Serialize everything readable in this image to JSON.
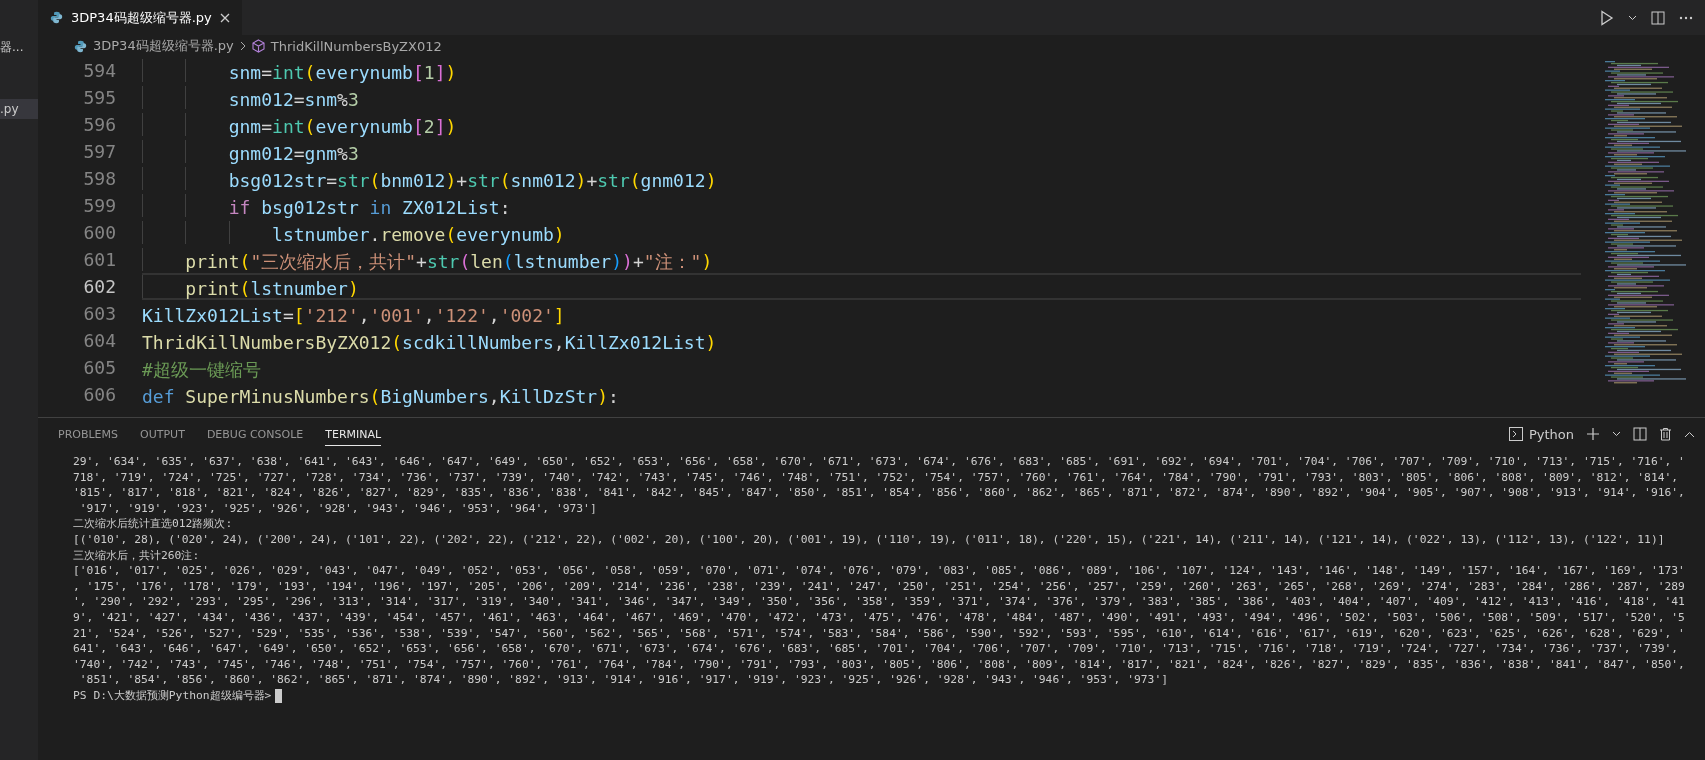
{
  "sidebar_fragment": {
    "items": [
      {
        "label": "器...",
        "selected": false
      },
      {
        "label": ".py",
        "selected": true
      }
    ]
  },
  "editor_tabs": [
    {
      "label": "3DP34码超级缩号器.py",
      "selected": true
    }
  ],
  "breadcrumb": [
    {
      "label": "3DP34码超级缩号器.py",
      "kind": "file"
    },
    {
      "label": "ThridKillNumbersByZX012",
      "kind": "symbol"
    }
  ],
  "code_lines": [
    {
      "number": "594",
      "selected": false,
      "tokens": [
        {
          "kind": "variable",
          "text": "        snm"
        },
        {
          "kind": "plain",
          "text": "="
        },
        {
          "kind": "builtin",
          "text": "int"
        },
        {
          "kind": "bracket1",
          "text": "("
        },
        {
          "kind": "variable",
          "text": "everynumb"
        },
        {
          "kind": "bracket2",
          "text": "["
        },
        {
          "kind": "number",
          "text": "1"
        },
        {
          "kind": "bracket2",
          "text": "]"
        },
        {
          "kind": "bracket1",
          "text": ")"
        }
      ]
    },
    {
      "number": "595",
      "selected": false,
      "tokens": [
        {
          "kind": "variable",
          "text": "        snm012"
        },
        {
          "kind": "plain",
          "text": "="
        },
        {
          "kind": "variable",
          "text": "snm"
        },
        {
          "kind": "plain",
          "text": "%"
        },
        {
          "kind": "number",
          "text": "3"
        }
      ]
    },
    {
      "number": "596",
      "selected": false,
      "tokens": [
        {
          "kind": "variable",
          "text": "        gnm"
        },
        {
          "kind": "plain",
          "text": "="
        },
        {
          "kind": "builtin",
          "text": "int"
        },
        {
          "kind": "bracket1",
          "text": "("
        },
        {
          "kind": "variable",
          "text": "everynumb"
        },
        {
          "kind": "bracket2",
          "text": "["
        },
        {
          "kind": "number",
          "text": "2"
        },
        {
          "kind": "bracket2",
          "text": "]"
        },
        {
          "kind": "bracket1",
          "text": ")"
        }
      ]
    },
    {
      "number": "597",
      "selected": false,
      "tokens": [
        {
          "kind": "variable",
          "text": "        gnm012"
        },
        {
          "kind": "plain",
          "text": "="
        },
        {
          "kind": "variable",
          "text": "gnm"
        },
        {
          "kind": "plain",
          "text": "%"
        },
        {
          "kind": "number",
          "text": "3"
        }
      ]
    },
    {
      "number": "598",
      "selected": false,
      "tokens": [
        {
          "kind": "variable",
          "text": "        bsg012str"
        },
        {
          "kind": "plain",
          "text": "="
        },
        {
          "kind": "builtin",
          "text": "str"
        },
        {
          "kind": "bracket1",
          "text": "("
        },
        {
          "kind": "variable",
          "text": "bnm012"
        },
        {
          "kind": "bracket1",
          "text": ")"
        },
        {
          "kind": "plain",
          "text": "+"
        },
        {
          "kind": "builtin",
          "text": "str"
        },
        {
          "kind": "bracket1",
          "text": "("
        },
        {
          "kind": "variable",
          "text": "snm012"
        },
        {
          "kind": "bracket1",
          "text": ")"
        },
        {
          "kind": "plain",
          "text": "+"
        },
        {
          "kind": "builtin",
          "text": "str"
        },
        {
          "kind": "bracket1",
          "text": "("
        },
        {
          "kind": "variable",
          "text": "gnm012"
        },
        {
          "kind": "bracket1",
          "text": ")"
        }
      ]
    },
    {
      "number": "599",
      "selected": false,
      "tokens": [
        {
          "kind": "control",
          "text": "        if "
        },
        {
          "kind": "variable",
          "text": "bsg012str "
        },
        {
          "kind": "operator",
          "text": "in "
        },
        {
          "kind": "variable",
          "text": "ZX012List"
        },
        {
          "kind": "plain",
          "text": ":"
        }
      ]
    },
    {
      "number": "600",
      "selected": false,
      "tokens": [
        {
          "kind": "variable",
          "text": "            lstnumber"
        },
        {
          "kind": "plain",
          "text": "."
        },
        {
          "kind": "function",
          "text": "remove"
        },
        {
          "kind": "bracket1",
          "text": "("
        },
        {
          "kind": "variable",
          "text": "everynumb"
        },
        {
          "kind": "bracket1",
          "text": ")"
        }
      ]
    },
    {
      "number": "601",
      "selected": false,
      "tokens": [
        {
          "kind": "function",
          "text": "    print"
        },
        {
          "kind": "bracket1",
          "text": "("
        },
        {
          "kind": "string",
          "text": "\"三次缩水后，共计\""
        },
        {
          "kind": "plain",
          "text": "+"
        },
        {
          "kind": "builtin",
          "text": "str"
        },
        {
          "kind": "bracket2",
          "text": "("
        },
        {
          "kind": "function",
          "text": "len"
        },
        {
          "kind": "bracket3",
          "text": "("
        },
        {
          "kind": "variable",
          "text": "lstnumber"
        },
        {
          "kind": "bracket3",
          "text": ")"
        },
        {
          "kind": "bracket2",
          "text": ")"
        },
        {
          "kind": "plain",
          "text": "+"
        },
        {
          "kind": "string",
          "text": "\"注：\""
        },
        {
          "kind": "bracket1",
          "text": ")"
        }
      ]
    },
    {
      "number": "602",
      "selected": true,
      "tokens": [
        {
          "kind": "function",
          "text": "    print"
        },
        {
          "kind": "bracket1",
          "text": "("
        },
        {
          "kind": "variable",
          "text": "lstnumber"
        },
        {
          "kind": "bracket1",
          "text": ")"
        }
      ]
    },
    {
      "number": "603",
      "selected": false,
      "tokens": [
        {
          "kind": "variable",
          "text": "KillZx012List"
        },
        {
          "kind": "plain",
          "text": "="
        },
        {
          "kind": "bracket1",
          "text": "["
        },
        {
          "kind": "string",
          "text": "'212'"
        },
        {
          "kind": "plain",
          "text": ","
        },
        {
          "kind": "string",
          "text": "'001'"
        },
        {
          "kind": "plain",
          "text": ","
        },
        {
          "kind": "string",
          "text": "'122'"
        },
        {
          "kind": "plain",
          "text": ","
        },
        {
          "kind": "string",
          "text": "'002'"
        },
        {
          "kind": "bracket1",
          "text": "]"
        }
      ]
    },
    {
      "number": "604",
      "selected": false,
      "tokens": [
        {
          "kind": "function",
          "text": "ThridKillNumbersByZX012"
        },
        {
          "kind": "bracket1",
          "text": "("
        },
        {
          "kind": "variable",
          "text": "scdkillNumbers"
        },
        {
          "kind": "plain",
          "text": ","
        },
        {
          "kind": "variable",
          "text": "KillZx012List"
        },
        {
          "kind": "bracket1",
          "text": ")"
        }
      ]
    },
    {
      "number": "605",
      "selected": false,
      "tokens": [
        {
          "kind": "comment",
          "text": "#超级一键缩号"
        }
      ]
    },
    {
      "number": "606",
      "selected": false,
      "tokens": [
        {
          "kind": "keyword",
          "text": "def "
        },
        {
          "kind": "function",
          "text": "SuperMinusNumbers"
        },
        {
          "kind": "bracket1",
          "text": "("
        },
        {
          "kind": "variable",
          "text": "BigNumbers"
        },
        {
          "kind": "plain",
          "text": ","
        },
        {
          "kind": "variable",
          "text": "KillDzStr"
        },
        {
          "kind": "bracket1",
          "text": ")"
        },
        {
          "kind": "plain",
          "text": ":"
        }
      ]
    }
  ],
  "panel_tabs": [
    {
      "label": "PROBLEMS",
      "selected": false
    },
    {
      "label": "OUTPUT",
      "selected": false
    },
    {
      "label": "DEBUG CONSOLE",
      "selected": false
    },
    {
      "label": "TERMINAL",
      "selected": true
    }
  ],
  "terminal": {
    "shell": "Python",
    "lines": [
      "29', '634', '635', '637', '638', '641', '643', '646', '647', '649', '650', '652', '653', '656', '658', '670', '671', '673', '674', '676', '683', '685', '691', '692', '694', '701', '704', '706', '707', '709', '710', '713', '715', '716', '",
      "718', '719', '724', '725', '727', '728', '734', '736', '737', '739', '740', '742', '743', '745', '746', '748', '751', '752', '754', '757', '760', '761', '764', '784', '790', '791', '793', '803', '805', '806', '808', '809', '812', '814',",
      "'815', '817', '818', '821', '824', '826', '827', '829', '835', '836', '838', '841', '842', '845', '847', '850', '851', '854', '856', '860', '862', '865', '871', '872', '874', '890', '892', '904', '905', '907', '908', '913', '914', '916',",
      " '917', '919', '923', '925', '926', '928', '943', '946', '953', '964', '973']",
      "二次缩水后统计直选012路频次:",
      "[('010', 28), ('020', 24), ('200', 24), ('101', 22), ('202', 22), ('212', 22), ('002', 20), ('100', 20), ('001', 19), ('110', 19), ('011', 18), ('220', 15), ('221', 14), ('211', 14), ('121', 14), ('022', 13), ('112', 13), ('122', 11)]",
      "三次缩水后，共计260注:",
      "['016', '017', '025', '026', '029', '043', '047', '049', '052', '053', '056', '058', '059', '070', '071', '074', '076', '079', '083', '085', '086', '089', '106', '107', '124', '143', '146', '148', '149', '157', '164', '167', '169', '173'",
      ", '175', '176', '178', '179', '193', '194', '196', '197', '205', '206', '209', '214', '236', '238', '239', '241', '247', '250', '251', '254', '256', '257', '259', '260', '263', '265', '268', '269', '274', '283', '284', '286', '287', '289",
      "', '290', '292', '293', '295', '296', '313', '314', '317', '319', '340', '341', '346', '347', '349', '350', '356', '358', '359', '371', '374', '376', '379', '383', '385', '386', '403', '404', '407', '409', '412', '413', '416', '418', '41",
      "9', '421', '427', '434', '436', '437', '439', '454', '457', '461', '463', '464', '467', '469', '470', '472', '473', '475', '476', '478', '484', '487', '490', '491', '493', '494', '496', '502', '503', '506', '508', '509', '517', '520', '5",
      "21', '524', '526', '527', '529', '535', '536', '538', '539', '547', '560', '562', '565', '568', '571', '574', '583', '584', '586', '590', '592', '593', '595', '610', '614', '616', '617', '619', '620', '623', '625', '626', '628', '629', '",
      "641', '643', '646', '647', '649', '650', '652', '653', '656', '658', '670', '671', '673', '674', '676', '683', '685', '701', '704', '706', '707', '709', '710', '713', '715', '716', '718', '719', '724', '727', '734', '736', '737', '739',",
      "'740', '742', '743', '745', '746', '748', '751', '754', '757', '760', '761', '764', '784', '790', '791', '793', '803', '805', '806', '808', '809', '814', '817', '821', '824', '826', '827', '829', '835', '836', '838', '841', '847', '850',",
      " '851', '854', '856', '860', '862', '865', '871', '874', '890', '892', '913', '914', '916', '917', '919', '923', '925', '926', '928', '943', '946', '953', '973']"
    ],
    "prompt": "PS D:\\大数据预测Python超级编号器>"
  }
}
